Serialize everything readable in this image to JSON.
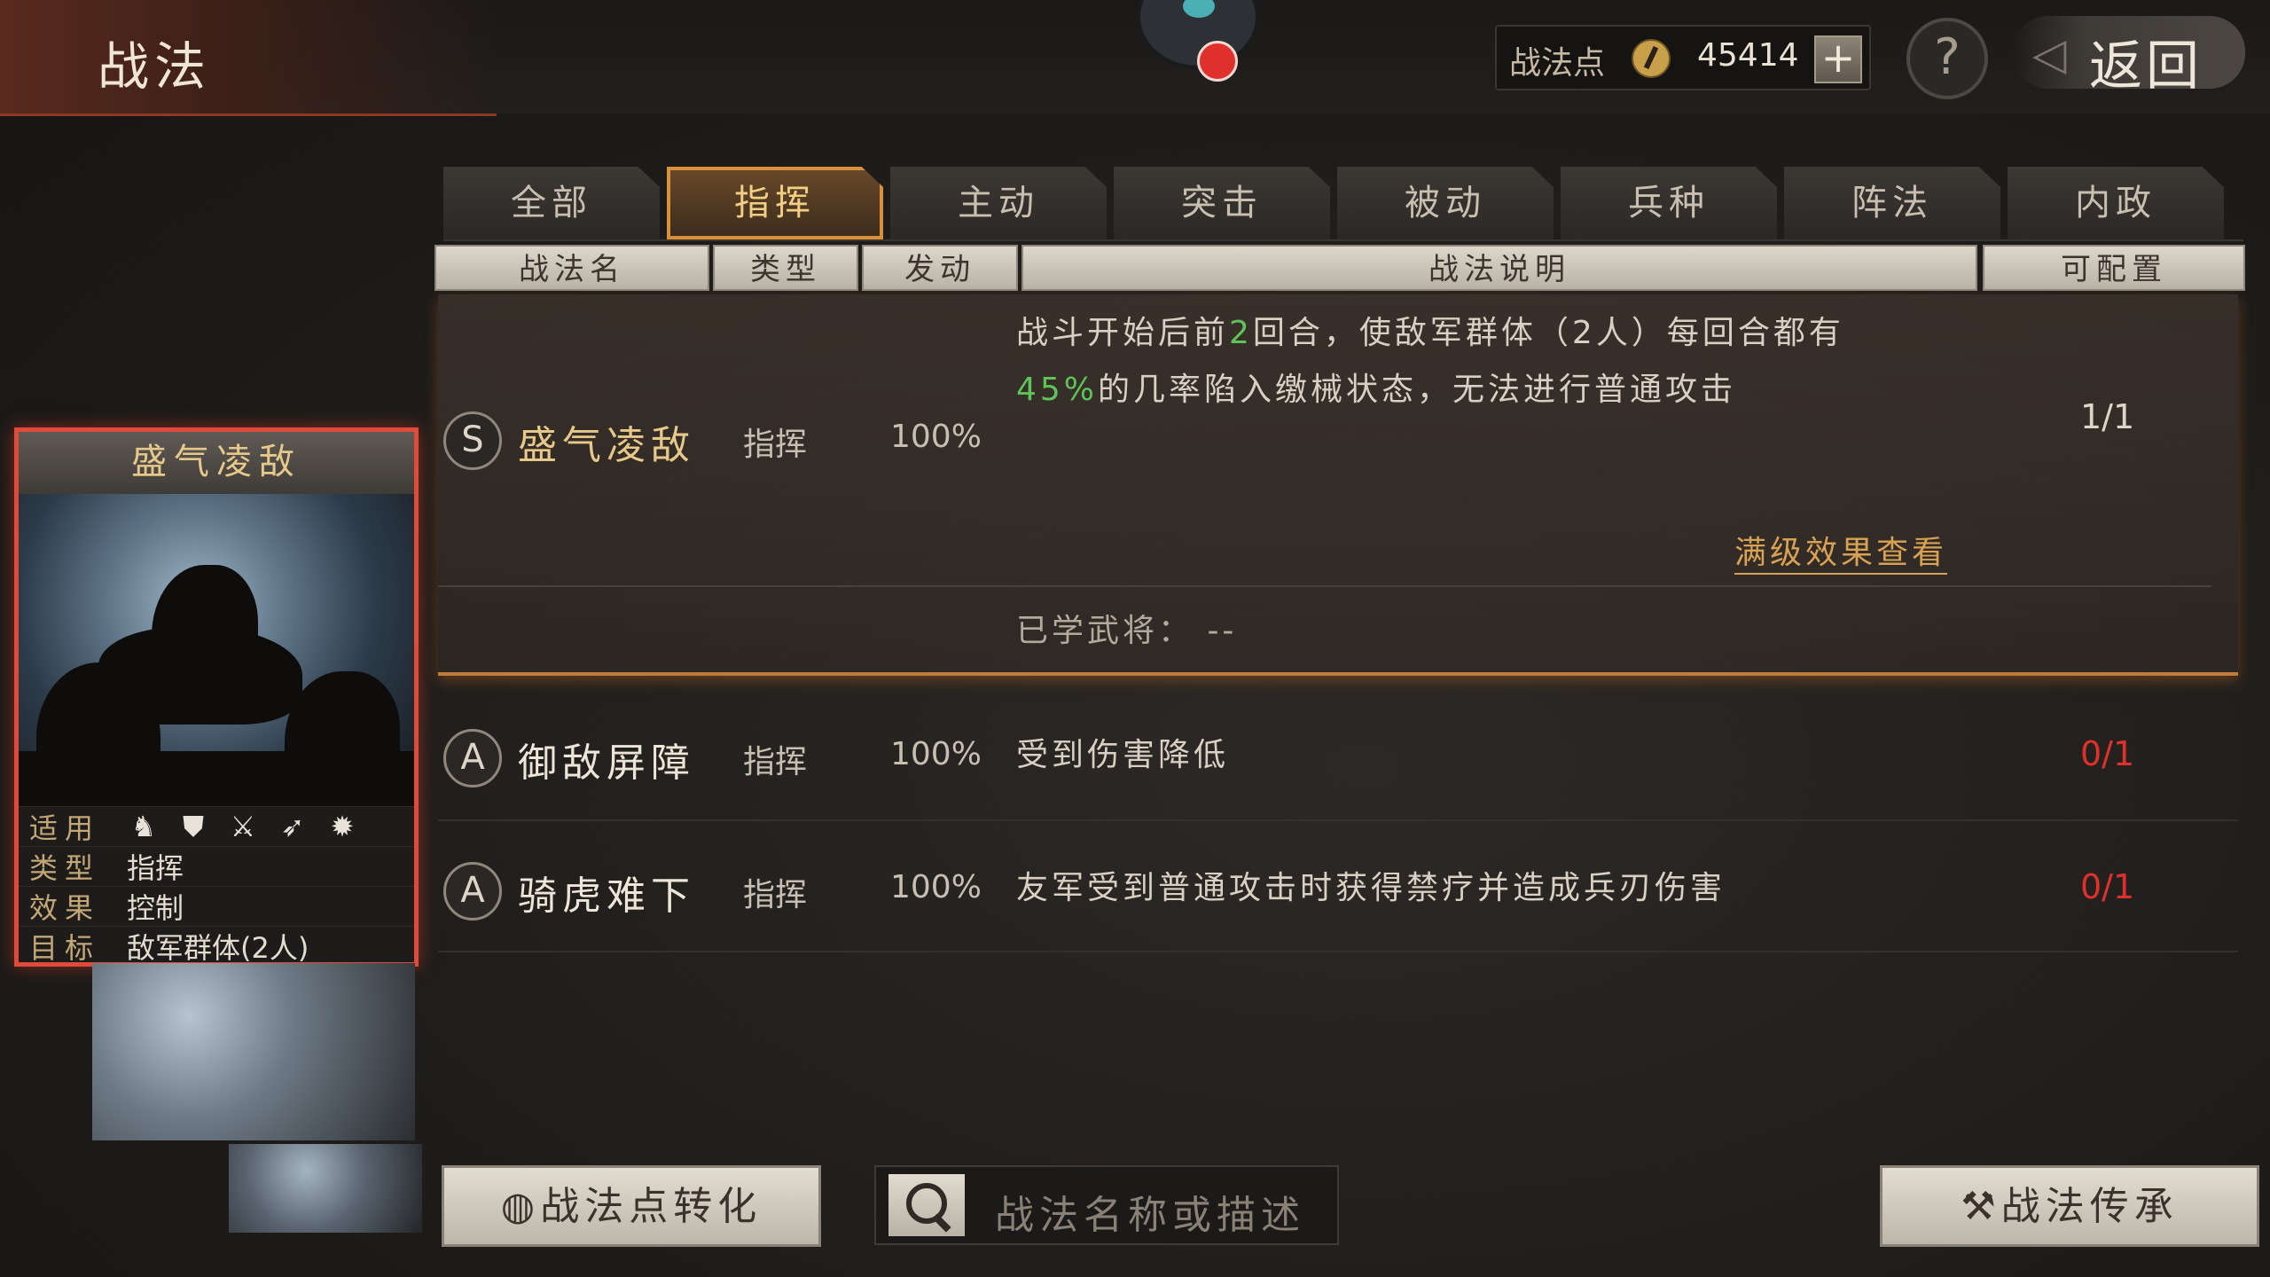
{
  "header": {
    "title": "战法",
    "points_label": "战法点",
    "points_value": "45414",
    "plus_label": "+",
    "help_label": "?",
    "back_label": "返回"
  },
  "tabs": [
    {
      "label": "全部"
    },
    {
      "label": "指挥",
      "active": true
    },
    {
      "label": "主动"
    },
    {
      "label": "突击"
    },
    {
      "label": "被动"
    },
    {
      "label": "兵种"
    },
    {
      "label": "阵法"
    },
    {
      "label": "内政"
    }
  ],
  "columns": {
    "name": "战法名",
    "type": "类型",
    "trigger": "发动",
    "desc": "战法说明",
    "config": "可配置"
  },
  "skills": [
    {
      "grade": "S",
      "name": "盛气凌敌",
      "type": "指挥",
      "prob": "100%",
      "desc_line1_a": "战斗开始后前",
      "desc_line1_hl": "2",
      "desc_line1_b": "回合，使敌军群体（2人）每回合都有",
      "desc_line2_hl": "45%",
      "desc_line2_b": "的几率陷入缴械状态，无法进行普通攻击",
      "count": "1/1",
      "full_link": "满级效果查看",
      "learned": "已学武将：  --"
    },
    {
      "grade": "A",
      "name": "御敌屏障",
      "type": "指挥",
      "prob": "100%",
      "desc": "受到伤害降低",
      "count": "0/1"
    },
    {
      "grade": "A",
      "name": "骑虎难下",
      "type": "指挥",
      "prob": "100%",
      "desc": "友军受到普通攻击时获得禁疗并造成兵刃伤害",
      "count": "0/1"
    }
  ],
  "card": {
    "title": "盛气凌敌",
    "rows": [
      {
        "k": "适用",
        "v": ""
      },
      {
        "k": "类型",
        "v": "指挥"
      },
      {
        "k": "效果",
        "v": "控制"
      },
      {
        "k": "目标",
        "v": "敌军群体(2人)"
      }
    ],
    "unit_icons": [
      "cavalry-icon",
      "shield-icon",
      "crossed-swords-icon",
      "bow-icon",
      "siege-icon"
    ]
  },
  "bottom": {
    "convert_label": "战法点转化",
    "search_placeholder": "战法名称或描述",
    "inherit_label": "战法传承"
  },
  "colors": {
    "accent_gold": "#e6c98a",
    "highlight_green": "#5fc35a",
    "count_red": "#e0302c",
    "card_border": "#e04a3a"
  }
}
